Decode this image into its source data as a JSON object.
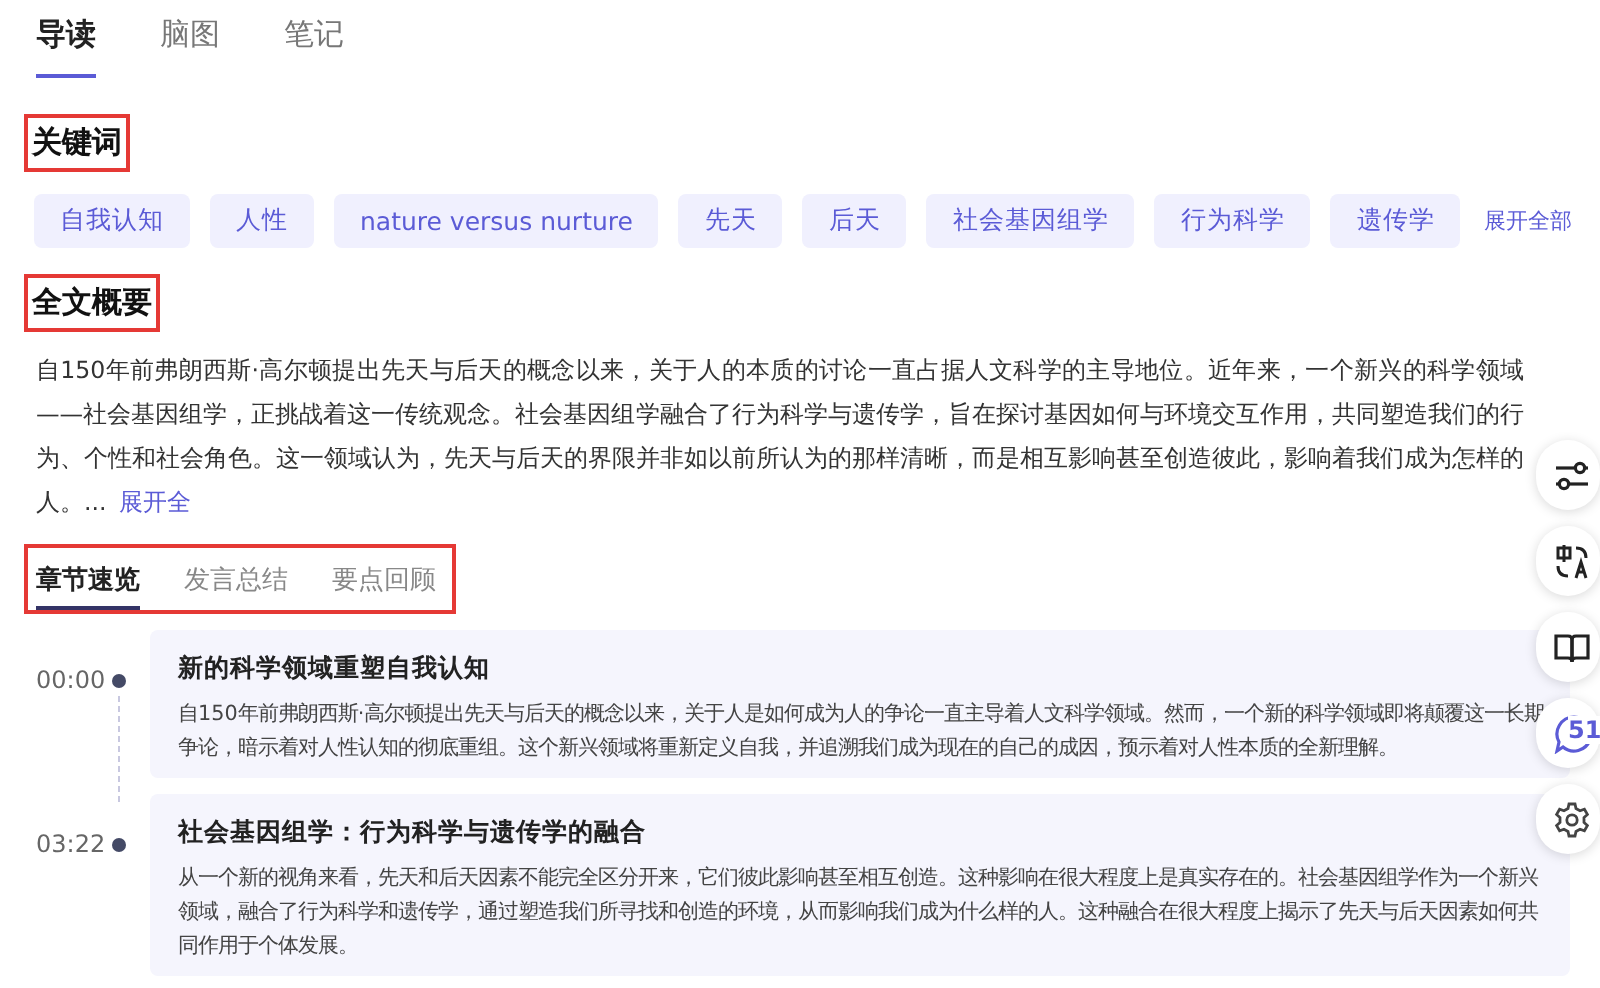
{
  "tabs": [
    {
      "label": "导读",
      "selected": true
    },
    {
      "label": "脑图",
      "selected": false
    },
    {
      "label": "笔记",
      "selected": false
    }
  ],
  "keywords": {
    "title": "关键词",
    "highlighted": true,
    "tags": [
      "自我认知",
      "人性",
      "nature versus nurture",
      "先天",
      "后天",
      "社会基因组学",
      "行为科学",
      "遗传学"
    ],
    "expand": "展开全部"
  },
  "summary": {
    "title": "全文概要",
    "highlighted": true,
    "text": "自150年前弗朗西斯·高尔顿提出先天与后天的概念以来，关于人的本质的讨论一直占据人文科学的主导地位。近年来，一个新兴的科学领域——社会基因组学，正挑战着这一传统观念。社会基因组学融合了行为科学与遗传学，旨在探讨基因如何与环境交互作用，共同塑造我们的行为、个性和社会角色。这一领域认为，先天与后天的界限并非如以前所认为的那样清晰，而是相互影响甚至创造彼此，影响着我们成为怎样的人。...",
    "expand": "展开全"
  },
  "sub_tabs": {
    "highlighted": true,
    "items": [
      {
        "label": "章节速览",
        "selected": true
      },
      {
        "label": "发言总结",
        "selected": false
      },
      {
        "label": "要点回顾",
        "selected": false
      }
    ]
  },
  "chapters": [
    {
      "time": "00:00",
      "title": "新的科学领域重塑自我认知",
      "text": "自150年前弗朗西斯·高尔顿提出先天与后天的概念以来，关于人是如何成为人的争论一直主导着人文科学领域。然而，一个新的科学领域即将颠覆这一长期争论，暗示着对人性认知的彻底重组。这个新兴领域将重新定义自我，并追溯我们成为现在的自己的成因，预示着对人性本质的全新理解。"
    },
    {
      "time": "03:22",
      "title": "社会基因组学：行为科学与遗传学的融合",
      "text": "从一个新的视角来看，先天和后天因素不能完全区分开来，它们彼此影响甚至相互创造。这种影响在很大程度上是真实存在的。社会基因组学作为一个新兴领域，融合了行为科学和遗传学，通过塑造我们所寻找和创造的环境，从而影响我们成为什么样的人。这种融合在很大程度上揭示了先天与后天因素如何共同作用于个体发展。"
    }
  ],
  "toolbar": {
    "buttons": [
      {
        "kind": "sliders"
      },
      {
        "kind": "translate"
      },
      {
        "kind": "book"
      },
      {
        "kind": "chat",
        "badge": "51"
      },
      {
        "kind": "gear"
      }
    ]
  }
}
